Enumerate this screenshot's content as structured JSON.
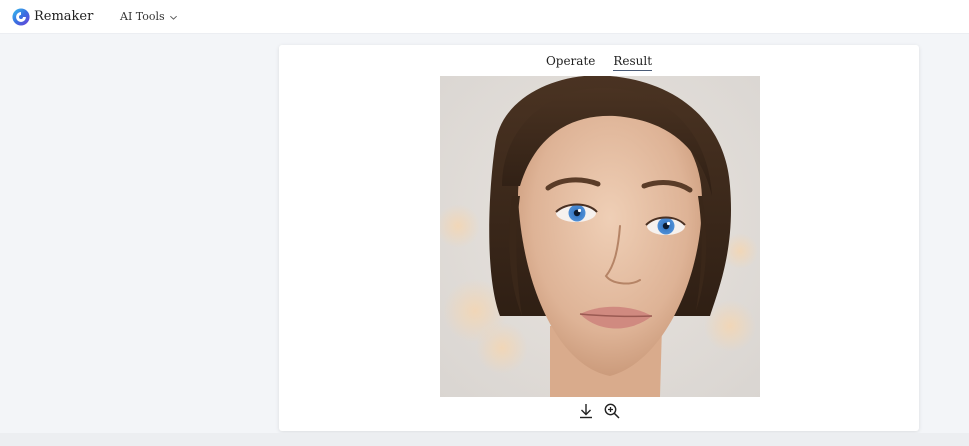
{
  "header": {
    "brand_name": "Remaker",
    "logo_icon": "remaker-swirl-logo",
    "tools_label": "AI Tools",
    "tools_chevron_icon": "chevron-down-icon"
  },
  "tabs": [
    {
      "label": "Operate",
      "active": false
    },
    {
      "label": "Result",
      "active": true
    }
  ],
  "result": {
    "image_subject": "portrait-face"
  },
  "actions": {
    "download_icon": "download-icon",
    "zoom_icon": "zoom-in-icon"
  },
  "colors": {
    "page_bg": "#f3f5f8",
    "card_bg": "#ffffff",
    "active_tab_underline": "#4a5b76",
    "logo_blue": "#3a6fe0"
  }
}
